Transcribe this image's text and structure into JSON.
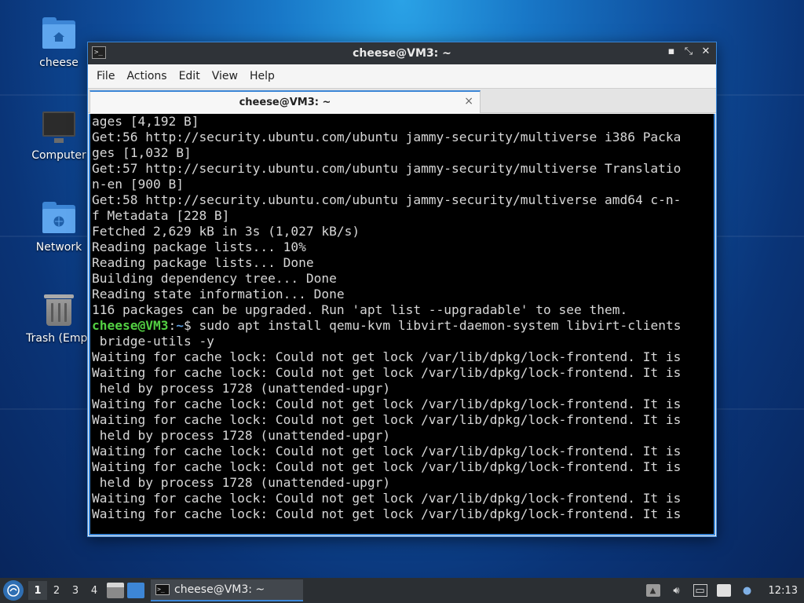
{
  "desktop": {
    "icons": [
      {
        "label": "cheese"
      },
      {
        "label": "Computer"
      },
      {
        "label": "Network"
      },
      {
        "label": "Trash (Empt"
      }
    ]
  },
  "window": {
    "title": "cheese@VM3: ~",
    "menu": [
      "File",
      "Edit",
      "View",
      "Help",
      "Actions"
    ],
    "menu_items": {
      "file": "File",
      "actions": "Actions",
      "edit": "Edit",
      "view": "View",
      "help": "Help"
    },
    "tab": {
      "label": "cheese@VM3: ~",
      "close": "×"
    },
    "controls": {
      "minimize": "▪",
      "maximize": "⤡",
      "close": "✕"
    }
  },
  "terminal": {
    "lines_before_prompt": [
      "ages [4,192 B]",
      "Get:56 http://security.ubuntu.com/ubuntu jammy-security/multiverse i386 Packa",
      "ges [1,032 B]",
      "Get:57 http://security.ubuntu.com/ubuntu jammy-security/multiverse Translatio",
      "n-en [900 B]",
      "Get:58 http://security.ubuntu.com/ubuntu jammy-security/multiverse amd64 c-n-",
      "f Metadata [228 B]",
      "Fetched 2,629 kB in 3s (1,027 kB/s)",
      "Reading package lists... 10%",
      "Reading package lists... Done",
      "Building dependency tree... Done",
      "Reading state information... Done",
      "116 packages can be upgraded. Run 'apt list --upgradable' to see them."
    ],
    "prompt_user": "cheese@VM3",
    "prompt_sep": ":",
    "prompt_path": "~",
    "command": "$ sudo apt install qemu-kvm libvirt-daemon-system libvirt-clients",
    "lines_after_prompt": [
      " bridge-utils -y",
      "Waiting for cache lock: Could not get lock /var/lib/dpkg/lock-frontend. It is",
      "Waiting for cache lock: Could not get lock /var/lib/dpkg/lock-frontend. It is",
      " held by process 1728 (unattended-upgr)",
      "Waiting for cache lock: Could not get lock /var/lib/dpkg/lock-frontend. It is",
      "Waiting for cache lock: Could not get lock /var/lib/dpkg/lock-frontend. It is",
      " held by process 1728 (unattended-upgr)",
      "Waiting for cache lock: Could not get lock /var/lib/dpkg/lock-frontend. It is",
      "Waiting for cache lock: Could not get lock /var/lib/dpkg/lock-frontend. It is",
      " held by process 1728 (unattended-upgr)",
      "Waiting for cache lock: Could not get lock /var/lib/dpkg/lock-frontend. It is",
      "Waiting for cache lock: Could not get lock /var/lib/dpkg/lock-frontend. It is"
    ]
  },
  "taskbar": {
    "workspaces": [
      "1",
      "2",
      "3",
      "4"
    ],
    "active_workspace": "1",
    "task_label": "cheese@VM3: ~",
    "clock": "12:13",
    "colors": {
      "accent": "#3b86d6",
      "panel": "#2b2f33"
    }
  }
}
